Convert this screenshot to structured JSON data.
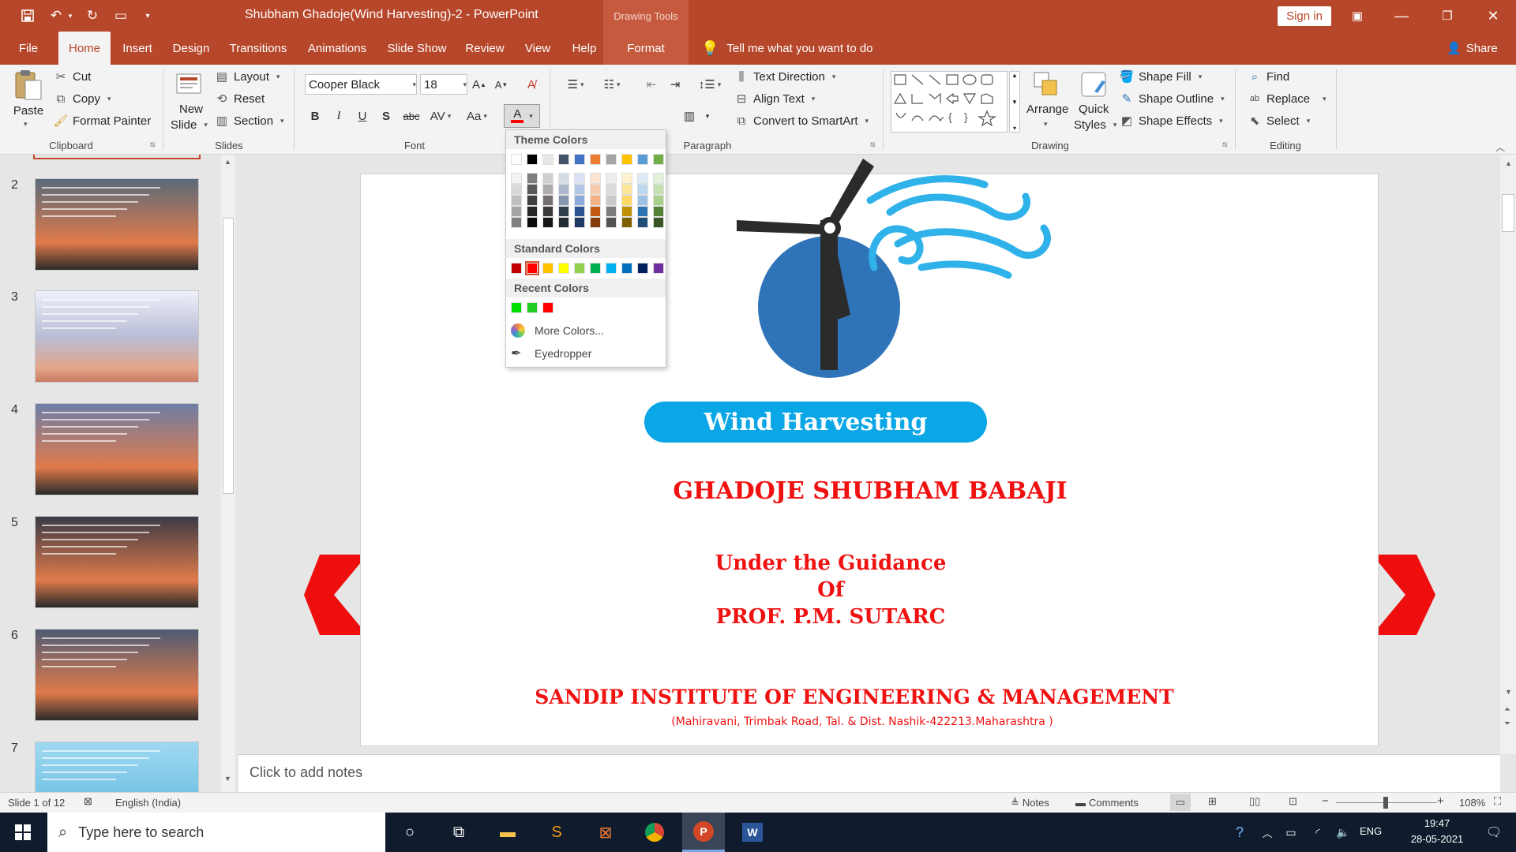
{
  "window": {
    "title": "Shubham Ghadoje(Wind Harvesting)-2  -  PowerPoint",
    "contextual_tab_group": "Drawing Tools",
    "sign_in": "Sign in"
  },
  "tabs": [
    "File",
    "Home",
    "Insert",
    "Design",
    "Transitions",
    "Animations",
    "Slide Show",
    "Review",
    "View",
    "Help",
    "Format"
  ],
  "tell_me": "Tell me what you want to do",
  "share": "Share",
  "ribbon": {
    "clipboard": {
      "paste": "Paste",
      "cut": "Cut",
      "copy": "Copy",
      "format_painter": "Format Painter",
      "label": "Clipboard"
    },
    "slides": {
      "new_slide_1": "New",
      "new_slide_2": "Slide",
      "layout": "Layout",
      "reset": "Reset",
      "section": "Section",
      "label": "Slides"
    },
    "font": {
      "name": "Cooper Black",
      "size": "18",
      "label": "Font",
      "bold": "B",
      "italic": "I",
      "underline": "U",
      "shadow": "S",
      "strike": "abc",
      "spacing": "AV",
      "case": "Aa",
      "grow": "A",
      "shrink": "A",
      "font_color": "A"
    },
    "paragraph": {
      "text_direction": "Text Direction",
      "align_text": "Align Text",
      "smartart": "Convert to SmartArt",
      "label": "Paragraph"
    },
    "drawing": {
      "arrange": "Arrange",
      "quick_styles_1": "Quick",
      "quick_styles_2": "Styles",
      "shape_fill": "Shape Fill",
      "shape_outline": "Shape Outline",
      "shape_effects": "Shape Effects",
      "label": "Drawing"
    },
    "editing": {
      "find": "Find",
      "replace": "Replace",
      "select": "Select",
      "label": "Editing"
    }
  },
  "color_picker": {
    "theme_header": "Theme Colors",
    "standard_header": "Standard Colors",
    "recent_header": "Recent Colors",
    "more_colors": "More Colors...",
    "eyedropper": "Eyedropper",
    "theme_top": [
      "#ffffff",
      "#000000",
      "#e7e6e6",
      "#44546a",
      "#4472c4",
      "#ed7d31",
      "#a5a5a5",
      "#ffc000",
      "#5b9bd5",
      "#70ad47"
    ],
    "theme_shades": [
      [
        "#f2f2f2",
        "#7f7f7f",
        "#d0cece",
        "#d6dce4",
        "#d9e2f3",
        "#fbe5d5",
        "#ededed",
        "#fff2cc",
        "#deebf6",
        "#e2efd9"
      ],
      [
        "#d8d8d8",
        "#595959",
        "#aeabab",
        "#adb9ca",
        "#b4c6e7",
        "#f7cbac",
        "#dbdbdb",
        "#fee599",
        "#bdd7ee",
        "#c5e0b3"
      ],
      [
        "#bfbfbf",
        "#3f3f3f",
        "#757070",
        "#8496b0",
        "#8eaadb",
        "#f4b183",
        "#c9c9c9",
        "#ffd965",
        "#9cc3e5",
        "#a8d08d"
      ],
      [
        "#a5a5a5",
        "#262626",
        "#3a3838",
        "#323f4f",
        "#2f5496",
        "#c55a11",
        "#7b7b7b",
        "#bf9000",
        "#2e75b5",
        "#538135"
      ],
      [
        "#7f7f7f",
        "#0c0c0c",
        "#171616",
        "#222a35",
        "#1f3864",
        "#833c0b",
        "#525252",
        "#7f6000",
        "#1f4e79",
        "#375623"
      ]
    ],
    "standard": [
      "#c00000",
      "#ff0000",
      "#ffc000",
      "#ffff00",
      "#92d050",
      "#00b050",
      "#00b0f0",
      "#0070c0",
      "#002060",
      "#7030a0"
    ],
    "recent": [
      "#00e000",
      "#22cc22",
      "#ff0000"
    ]
  },
  "thumbnails": [
    {
      "num": "2",
      "bg": "#5a6a7a"
    },
    {
      "num": "3",
      "bg": "#b9bdd6"
    },
    {
      "num": "4",
      "bg": "#6d7ea6"
    },
    {
      "num": "5",
      "bg": "#3b3a45"
    },
    {
      "num": "6",
      "bg": "#4f5b73"
    },
    {
      "num": "7",
      "bg": "#7ec6e6"
    }
  ],
  "slide": {
    "banner": "Wind Harvesting",
    "name": "GHADOJE SHUBHAM BABAJI",
    "guidance_1": "Under the Guidance",
    "guidance_2": "Of",
    "guidance_3": "PROF. P.M. SUTARC",
    "institute": "SANDIP INSTITUTE OF ENGINEERING & MANAGEMENT",
    "address": "(Mahiravani, Trimbak Road, Tal. & Dist. Nashik-422213.Maharashtra  )",
    "colors": {
      "text_red": "#f01111",
      "banner_blue": "#0aa6e6",
      "globe_blue": "#2f74b8",
      "wind_blue": "#2fb2ea"
    }
  },
  "notes_placeholder": "Click to add notes",
  "status": {
    "slide_of": "Slide 1 of 12",
    "language": "English (India)",
    "notes": "Notes",
    "comments": "Comments",
    "zoom": "108%"
  },
  "taskbar": {
    "search_placeholder": "Type here to search",
    "lang": "ENG",
    "time": "19:47",
    "date": "28-05-2021"
  }
}
